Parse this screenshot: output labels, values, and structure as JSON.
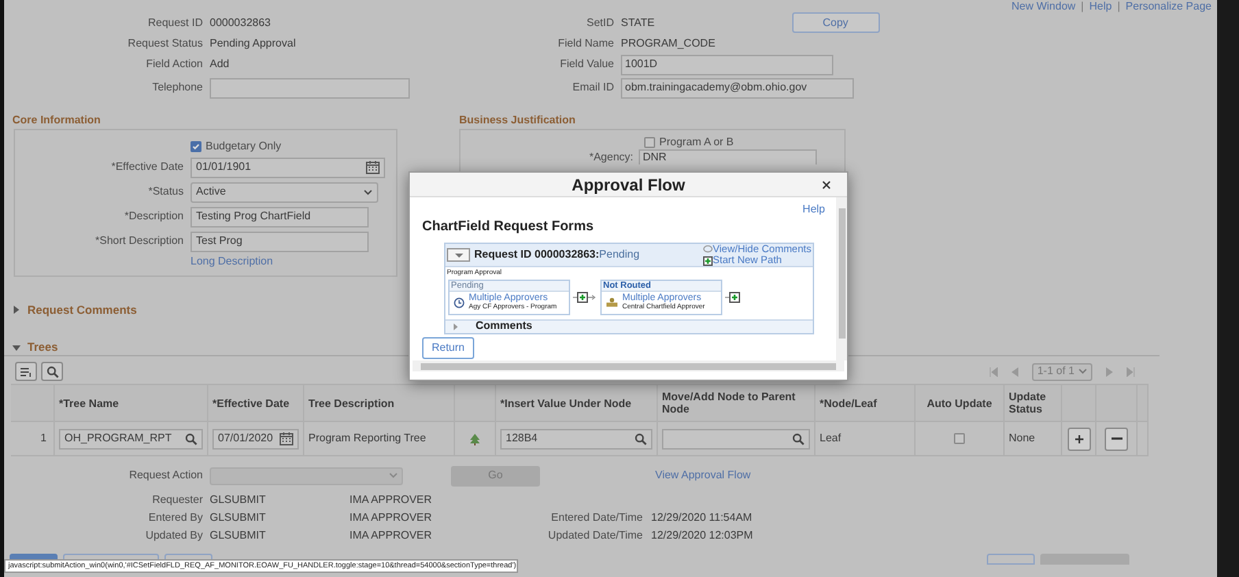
{
  "top_links": [
    {
      "label": "New Window"
    },
    {
      "label": "Help"
    },
    {
      "label": "Personalize Page"
    }
  ],
  "link_separator": "|",
  "header": {
    "left": [
      {
        "label": "Request ID",
        "value": "0000032863",
        "kind": "text"
      },
      {
        "label": "Request Status",
        "value": "Pending Approval",
        "kind": "text"
      },
      {
        "label": "Field Action",
        "value": "Add",
        "kind": "text"
      },
      {
        "label": "Telephone",
        "kind": "input"
      }
    ],
    "right": [
      {
        "label": "SetID",
        "value": "STATE",
        "kind": "text"
      },
      {
        "label": "Field Name",
        "value": "PROGRAM_CODE",
        "kind": "text"
      },
      {
        "label": "Field Value",
        "value": "1001D",
        "kind": "input"
      },
      {
        "label": "Email ID",
        "value": "obm.trainingacademy@obm.ohio.gov",
        "kind": "input"
      }
    ],
    "copy_button": "Copy"
  },
  "core_information": {
    "title": "Core Information",
    "budgetary_only": {
      "label": "Budgetary Only",
      "checked": true
    },
    "fields": [
      {
        "label": "*Effective Date",
        "value": "01/01/1901",
        "kind": "date"
      },
      {
        "label": "*Status",
        "value": "Active",
        "kind": "select"
      },
      {
        "label": "*Description",
        "value": "Testing Prog ChartField",
        "kind": "input"
      },
      {
        "label": "*Short Description",
        "value": "Test Prog",
        "kind": "input"
      }
    ],
    "long_description_link": "Long Description"
  },
  "business_justification": {
    "title": "Business Justification",
    "program_a_or_b": {
      "label": "Program A or B",
      "checked": false
    },
    "agency": {
      "label": "*Agency:",
      "value": "DNR"
    }
  },
  "sections": [
    {
      "title": "Request Comments",
      "expanded": false
    },
    {
      "title": "Trees",
      "expanded": true
    }
  ],
  "trees": {
    "pagination": "1-1 of 1",
    "columns": [
      "",
      "*Tree Name",
      "*Effective Date",
      "Tree Description",
      "",
      "*Insert Value Under Node",
      "Move/Add Node to Parent Node",
      "*Node/Leaf",
      "Auto Update",
      "Update Status",
      "",
      "",
      ""
    ],
    "rows": [
      {
        "cells": [
          {
            "kind": "index",
            "value": "1"
          },
          {
            "kind": "lookup",
            "value": "OH_PROGRAM_RPT"
          },
          {
            "kind": "date",
            "value": "07/01/2020"
          },
          {
            "kind": "text",
            "value": "Program Reporting Tree"
          },
          {
            "kind": "tree_icon"
          },
          {
            "kind": "lookup",
            "value": "128B4"
          },
          {
            "kind": "lookup"
          },
          {
            "kind": "text",
            "value": "Leaf"
          },
          {
            "kind": "checkbox",
            "checked": false
          },
          {
            "kind": "text",
            "value": "None"
          },
          {
            "kind": "add_button"
          },
          {
            "kind": "remove_button"
          },
          {
            "kind": "blank"
          }
        ]
      }
    ]
  },
  "request_action": {
    "label": "Request Action",
    "disabled": true
  },
  "go_button": {
    "label": "Go",
    "disabled": true
  },
  "view_approval_flow_link": "View Approval Flow",
  "people": [
    {
      "label": "Requester",
      "id": "GLSUBMIT",
      "name": "IMA APPROVER"
    },
    {
      "label": "Entered By",
      "id": "GLSUBMIT",
      "name": "IMA APPROVER",
      "date_label": "Entered Date/Time",
      "date": "12/29/2020 11:54AM"
    },
    {
      "label": "Updated By",
      "id": "GLSUBMIT",
      "name": "IMA APPROVER",
      "date_label": "Updated Date/Time",
      "date": "12/29/2020 12:03PM"
    }
  ],
  "status_bar": "javascript:submitAction_win0(win0,'#ICSetFieldFLD_REQ_AF_MONITOR.EOAW_FU_HANDLER.toggle:stage=10&thread=54000&sectionType=thread')",
  "modal": {
    "title": "Approval Flow",
    "help_link": "Help",
    "heading": "ChartField Request Forms",
    "request_label": "Request ID 0000032863:",
    "request_status": "Pending",
    "view_hide_comments": "View/Hide Comments",
    "start_new_path": "Start New Path",
    "path_name": "Program Approval",
    "steps": [
      {
        "kind": "pending",
        "status": "Pending",
        "title": "Multiple Approvers",
        "subtitle": "Agy CF Approvers - Program"
      },
      {
        "kind": "not_routed",
        "status": "Not Routed",
        "title": "Multiple Approvers",
        "subtitle": "Central Chartfield Approver"
      }
    ],
    "comments": {
      "label": "Comments",
      "expanded": false
    },
    "return_button": "Return"
  }
}
